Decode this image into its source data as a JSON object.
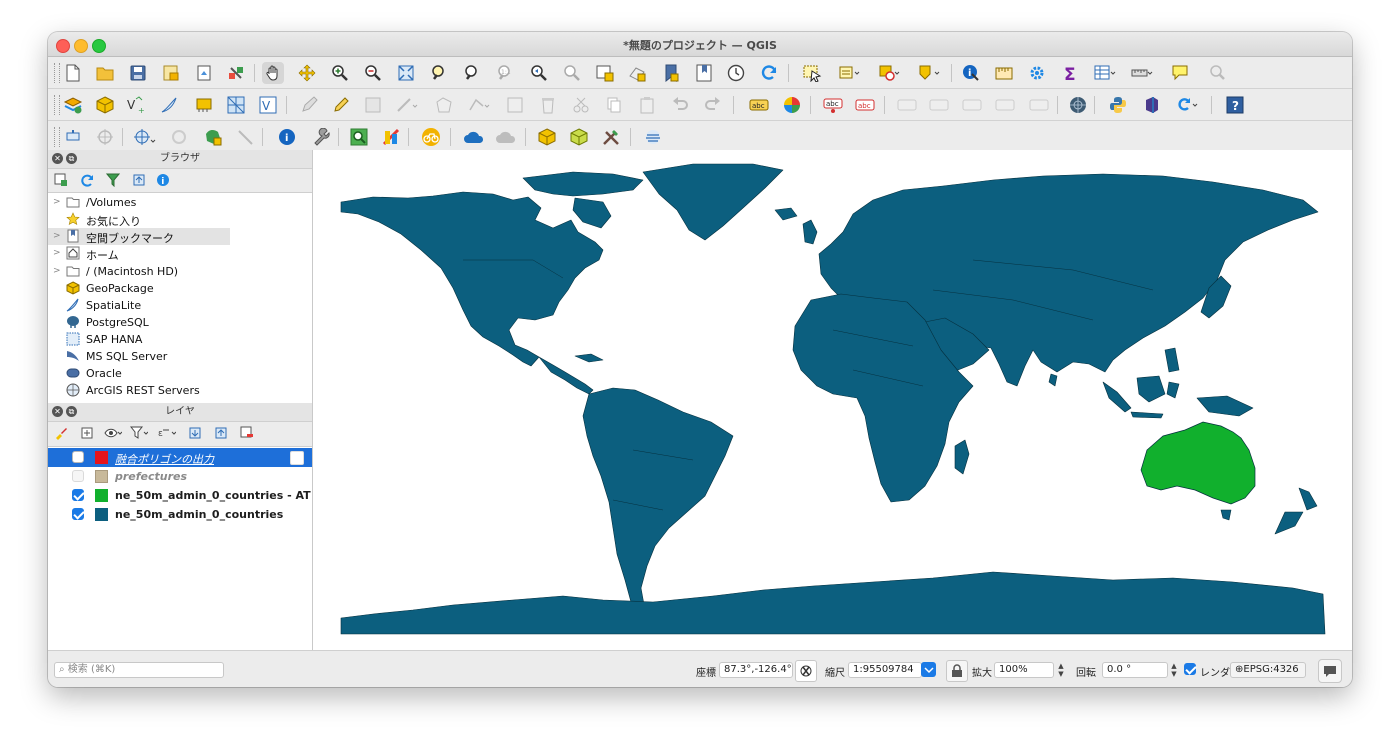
{
  "window": {
    "title": "*無題のプロジェクト — QGIS"
  },
  "browser_panel": {
    "title": "ブラウザ",
    "items": [
      {
        "label": "/Volumes",
        "icon": "folder-icon",
        "expandable": true
      },
      {
        "label": "お気に入り",
        "icon": "star-icon",
        "expandable": false
      },
      {
        "label": "空間ブックマーク",
        "icon": "bookmark-icon",
        "expandable": true
      },
      {
        "label": "ホーム",
        "icon": "home-icon",
        "expandable": true
      },
      {
        "label": "/ (Macintosh HD)",
        "icon": "folder-icon",
        "expandable": true
      },
      {
        "label": "GeoPackage",
        "icon": "geopackage-icon",
        "expandable": false
      },
      {
        "label": "SpatiaLite",
        "icon": "spatialite-icon",
        "expandable": false
      },
      {
        "label": "PostgreSQL",
        "icon": "postgresql-icon",
        "expandable": false
      },
      {
        "label": "SAP HANA",
        "icon": "sap-hana-icon",
        "expandable": false
      },
      {
        "label": "MS SQL Server",
        "icon": "mssql-icon",
        "expandable": false
      },
      {
        "label": "Oracle",
        "icon": "oracle-icon",
        "expandable": false
      },
      {
        "label": "ArcGIS REST Servers",
        "icon": "arcgis-icon",
        "expandable": false
      }
    ]
  },
  "layers_panel": {
    "title": "レイヤ",
    "layers": [
      {
        "name": "融合ポリゴンの出力",
        "checked": false,
        "color": "#e5131b",
        "selected": true,
        "style": "temporary"
      },
      {
        "name": "prefectures",
        "checked": false,
        "color": "#c8b99a",
        "selected": false,
        "style": "disabled"
      },
      {
        "name": "ne_50m_admin_0_countries - AT",
        "checked": true,
        "color": "#11b02d",
        "selected": false,
        "style": "normal"
      },
      {
        "name": "ne_50m_admin_0_countries",
        "checked": true,
        "color": "#0c5f7f",
        "selected": false,
        "style": "normal"
      }
    ]
  },
  "map": {
    "land_color": "#0c5f7f",
    "highlight_color": "#11b02d"
  },
  "statusbar": {
    "search_placeholder": "検索 (⌘K)",
    "coord_label": "座標",
    "coord_value": "87.3°,-126.4°",
    "scale_label": "縮尺",
    "scale_value": "1:95509784",
    "magnifier_label": "拡大",
    "magnifier_value": "100%",
    "rotation_label": "回転",
    "rotation_value": "0.0 °",
    "render_label": "レンダ",
    "render_checked": true,
    "crs_label": "EPSG:4326"
  }
}
